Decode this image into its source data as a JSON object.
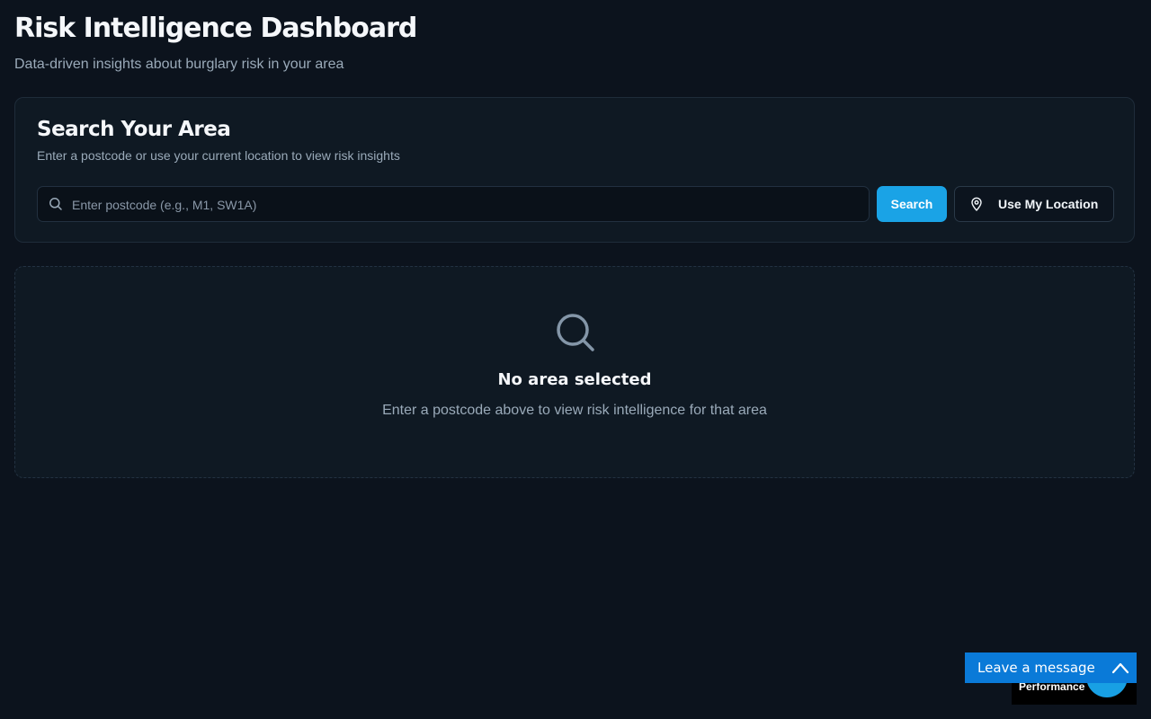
{
  "header": {
    "title": "Risk Intelligence Dashboard",
    "subtitle": "Data-driven insights about burglary risk in your area"
  },
  "search_card": {
    "title": "Search Your Area",
    "description": "Enter a postcode or use your current location to view risk insights",
    "input": {
      "value": "",
      "placeholder": "Enter postcode (e.g., M1, SW1A)",
      "icon": "search-icon"
    },
    "search_button": "Search",
    "location_button": {
      "label": "Use My Location",
      "icon": "map-pin-icon"
    }
  },
  "empty_state": {
    "icon": "search-icon",
    "title": "No area selected",
    "description": "Enter a postcode above to view risk intelligence for that area"
  },
  "widgets": {
    "performance_label": "Performance",
    "leave_message_label": "Leave a message",
    "leave_message_icon": "chevron-up-icon"
  },
  "colors": {
    "background": "#0c131d",
    "card": "#0f1923",
    "accent": "#1aa3e6",
    "chat_widget": "#0a7ad8"
  }
}
